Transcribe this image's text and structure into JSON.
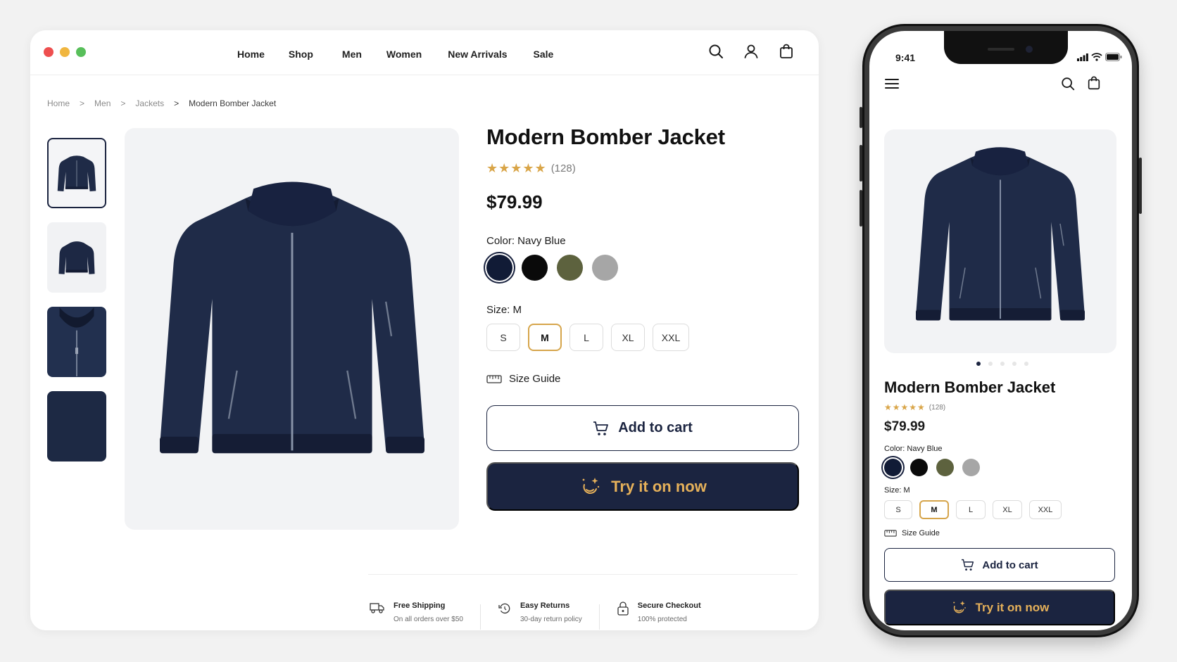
{
  "colors": {
    "accent": "#d9a548",
    "navy": "#1b2440",
    "traffic_lights": [
      "#ee4f4f",
      "#f0b640",
      "#58bf5a"
    ],
    "swatches": [
      "#111b36",
      "#0a0a0a",
      "#5d623e",
      "#a6a6a6"
    ]
  },
  "nav": {
    "items": [
      "Home",
      "Shop",
      "Men",
      "Women",
      "New Arrivals",
      "Sale"
    ],
    "icons": [
      "search-icon",
      "user-icon",
      "shopping-bag-icon"
    ]
  },
  "breadcrumb": [
    "Home",
    "Men",
    "Jackets",
    "Modern Bomber Jacket"
  ],
  "breadcrumb_sep": ">",
  "product": {
    "title": "Modern Bomber Jacket",
    "rating": 4.5,
    "stars": "★★★★★",
    "reviews": "(128)",
    "price": "$79.99",
    "color_label": "Color: Navy Blue",
    "size_label": "Size: M",
    "sizes": [
      "S",
      "M",
      "L",
      "XL",
      "XXL"
    ],
    "selected_size": "M",
    "size_guide": "Size Guide",
    "add_to_cart": "Add to cart",
    "try_on": "Try it on now"
  },
  "features": [
    {
      "icon": "truck-icon",
      "title": "Free Shipping",
      "subtitle": "On all orders over $50"
    },
    {
      "icon": "returns-icon",
      "title": "Easy Returns",
      "subtitle": "30-day return policy"
    },
    {
      "icon": "lock-icon",
      "title": "Secure Checkout",
      "subtitle": "100% protected"
    }
  ],
  "phone": {
    "time": "9:41",
    "carousel_count": 5,
    "carousel_active": 1
  }
}
